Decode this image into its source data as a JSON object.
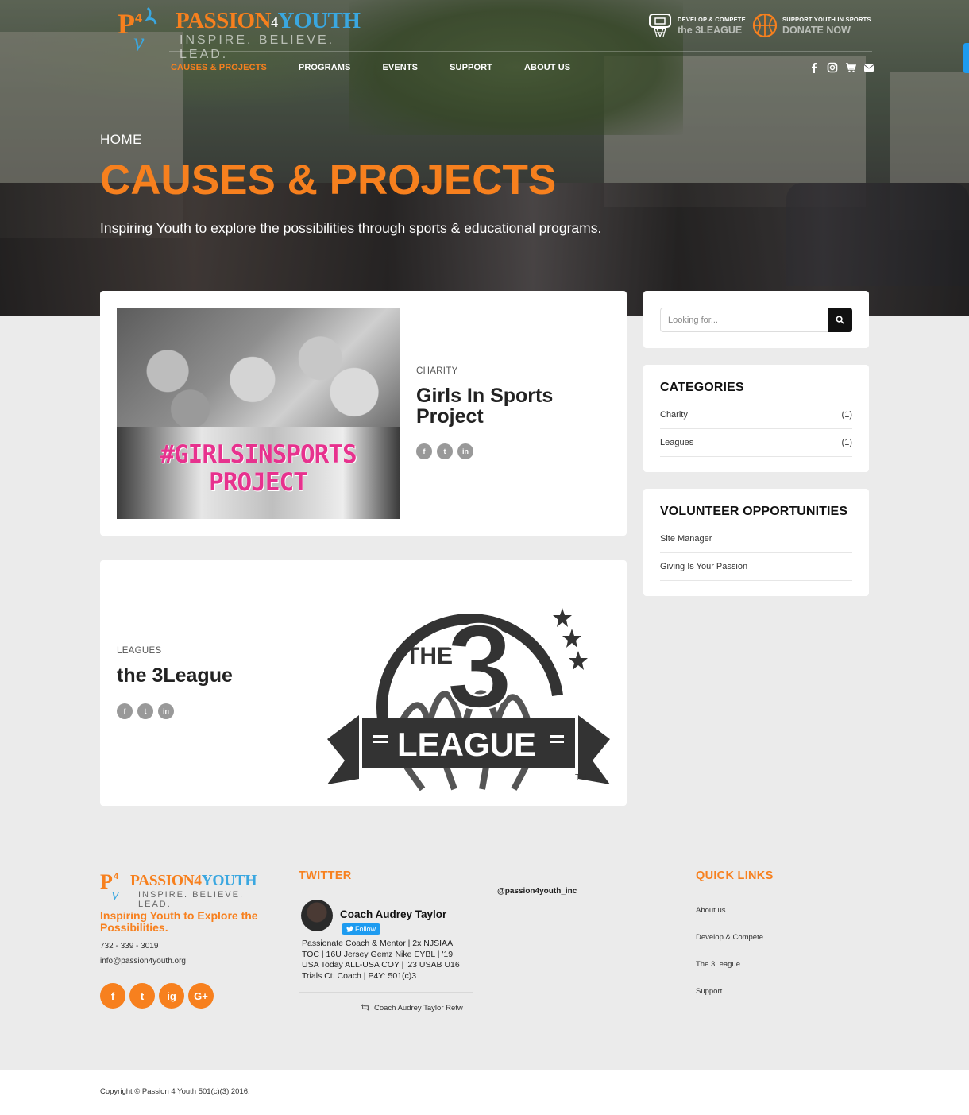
{
  "header": {
    "logo_word1": "PASSION",
    "logo_four": "4",
    "logo_word2": "YOUTH",
    "logo_tagline": "INSPIRE. BELIEVE. LEAD.",
    "cta1_small": "DEVELOP & COMPETE",
    "cta1_big": "the 3LEAGUE",
    "cta2_small": "SUPPORT YOUTH IN SPORTS",
    "cta2_big": "DONATE NOW",
    "nav": [
      "CAUSES & PROJECTS",
      "PROGRAMS",
      "EVENTS",
      "SUPPORT",
      "ABOUT US"
    ],
    "social_icons": [
      "facebook-icon",
      "instagram-icon",
      "cart-icon",
      "mail-icon"
    ]
  },
  "hero": {
    "breadcrumb": "HOME",
    "title": "CAUSES & PROJECTS",
    "subtitle": "Inspiring Youth to explore the possibilities through sports & educational programs."
  },
  "posts": [
    {
      "category": "CHARITY",
      "title": "Girls In Sports Project",
      "image_text": "#GIRLSINSPORTS PROJECT",
      "share": [
        "f",
        "t",
        "in"
      ]
    },
    {
      "category": "LEAGUES",
      "title": "the 3League",
      "image_text_top": "THE",
      "image_text_number": "3",
      "image_text_banner": "LEAGUE",
      "image_text_tm": "TM",
      "share": [
        "f",
        "t",
        "in"
      ]
    }
  ],
  "sidebar": {
    "search_placeholder": "Looking for...",
    "categories_title": "CATEGORIES",
    "categories": [
      {
        "name": "Charity",
        "count": "(1)"
      },
      {
        "name": "Leagues",
        "count": "(1)"
      }
    ],
    "volunteer_title": "VOLUNTEER OPPORTUNITIES",
    "volunteer": [
      "Site Manager",
      "Giving Is Your Passion"
    ]
  },
  "footer": {
    "logo_word1": "PASSION",
    "logo_four": "4",
    "logo_word2": "YOUTH",
    "logo_tagline": "INSPIRE. BELIEVE. LEAD.",
    "tagline": "Inspiring Youth to Explore the Possibilities.",
    "phone": "732 - 339 - 3019",
    "email": "info@passion4youth.org",
    "social": [
      "f",
      "t",
      "ig",
      "G+"
    ],
    "twitter_heading": "TWITTER",
    "twitter_name": "Coach Audrey Taylor",
    "twitter_follow": "Follow",
    "twitter_bio": "Passionate Coach & Mentor | 2x NJSIAA TOC | 16U Jersey Gemz Nike EYBL | '19 USA Today ALL-USA COY | '23 USAB U16 Trials Ct. Coach | P4Y: 501(c)3",
    "twitter_retweet": "Coach Audrey Taylor Retw",
    "instagram_handle": "@passion4youth_inc",
    "quick_links_heading": "QUICK LINKS",
    "quick_links": [
      "About us",
      "Develop & Compete",
      "The 3League",
      "Support"
    ],
    "copyright": "Copyright © Passion 4 Youth 501(c)(3) 2016."
  },
  "colors": {
    "accent": "#f7801e",
    "brand_blue": "#3aa7e0",
    "twitter_blue": "#1d9bf0"
  }
}
